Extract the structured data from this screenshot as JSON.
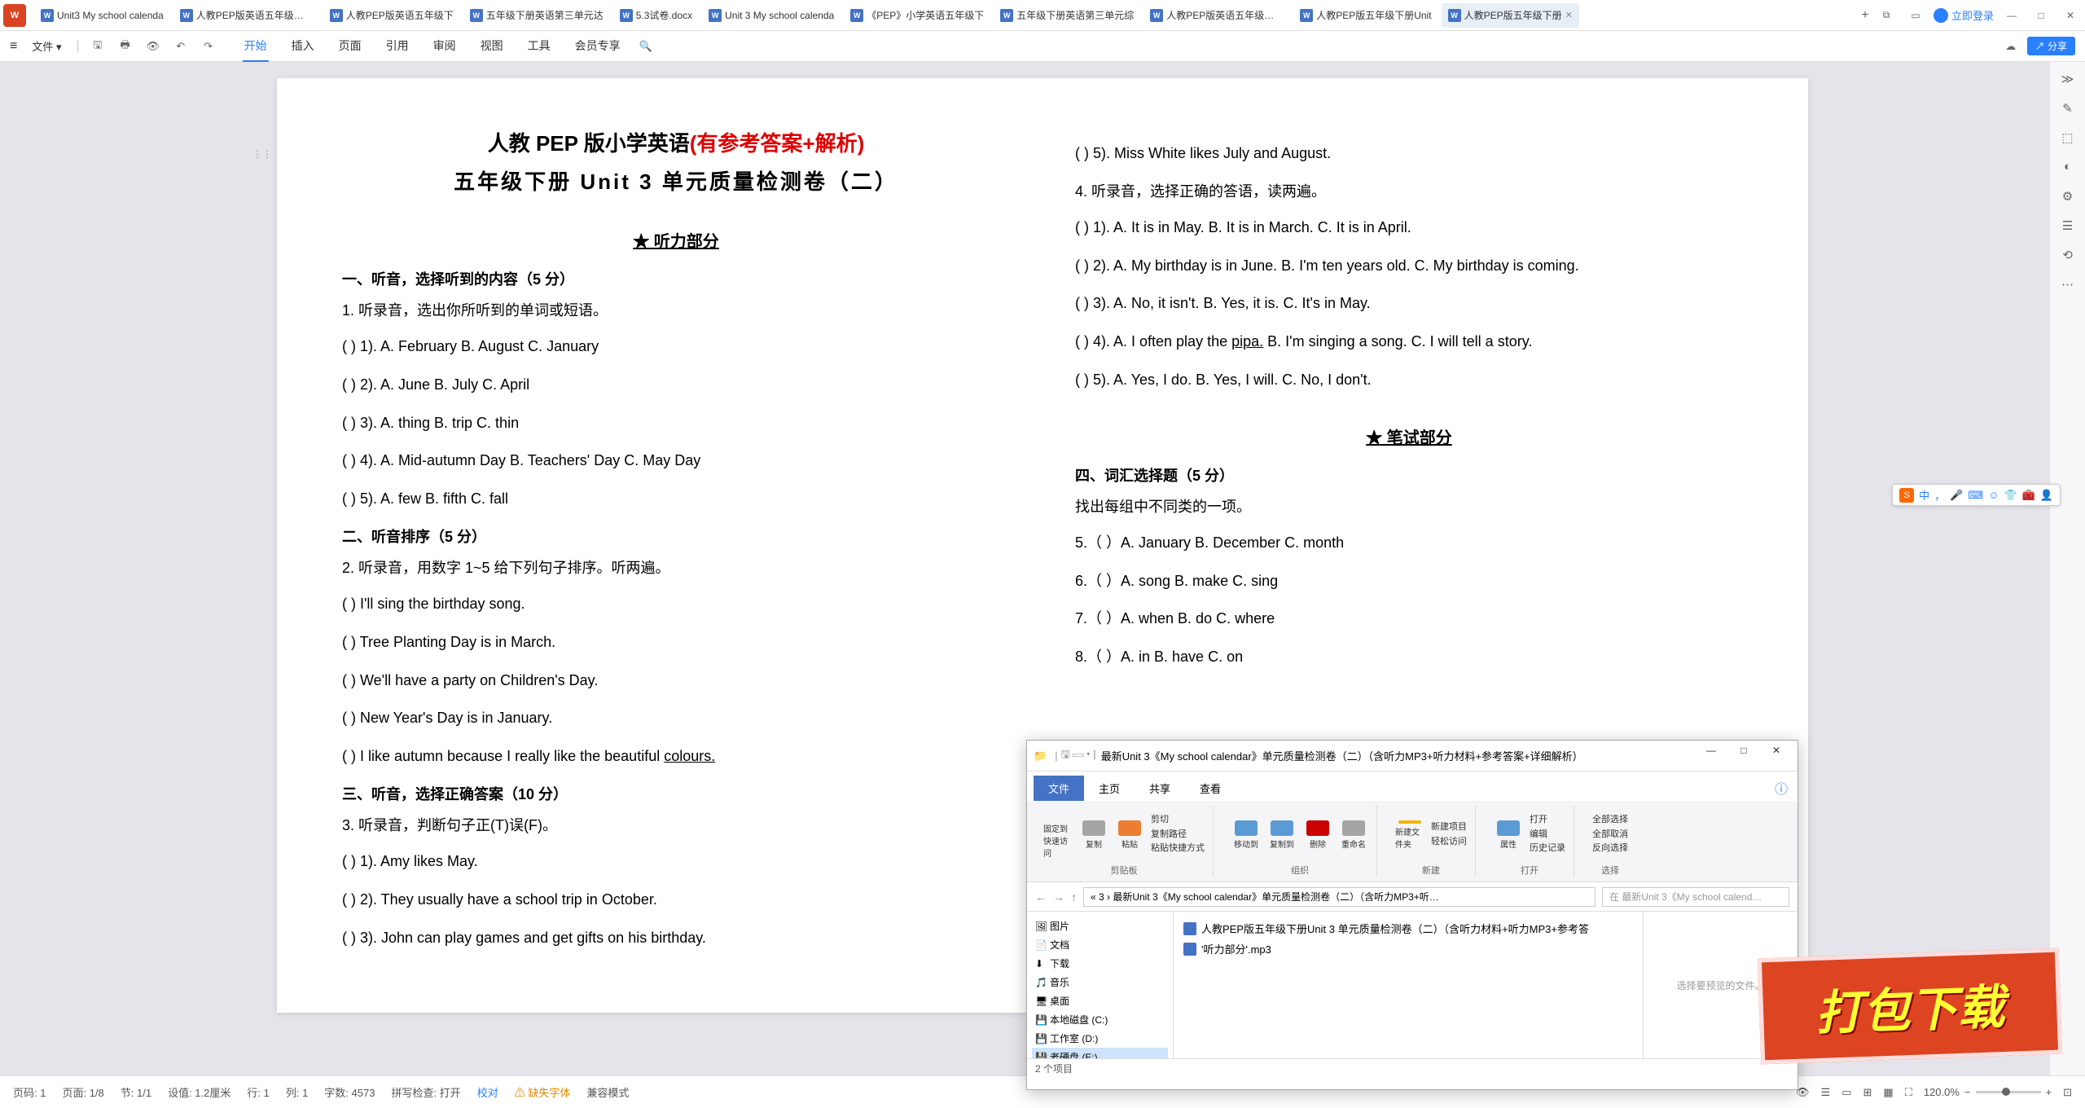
{
  "titlebar": {
    "tabs": [
      {
        "label": "Unit3  My school calenda"
      },
      {
        "label": "人教PEP版英语五年级下册U"
      },
      {
        "label": "人教PEP版英语五年级下"
      },
      {
        "label": "五年级下册英语第三单元达"
      },
      {
        "label": "5.3试卷.docx"
      },
      {
        "label": "Unit 3 My school calenda"
      },
      {
        "label": "《PEP》小学英语五年级下"
      },
      {
        "label": "五年级下册英语第三单元综"
      },
      {
        "label": "人教PEP版英语五年级下册U"
      },
      {
        "label": "人教PEP版五年级下册Unit"
      },
      {
        "label": "人教PEP版五年级下册"
      }
    ],
    "login": "立即登录",
    "share": "分享"
  },
  "ribbon": {
    "file": "文件",
    "tabs": [
      "开始",
      "插入",
      "页面",
      "引用",
      "审阅",
      "视图",
      "工具",
      "会员专享"
    ]
  },
  "doc": {
    "title1": "人教 PEP 版小学英语",
    "title_red": "(有参考答案+解析)",
    "title2": "五年级下册 Unit  3 单元质量检测卷（二）",
    "listening_header": "★  听力部分",
    "s1_title": "一、听音，选择听到的内容（5 分）",
    "s1_inst": "1.  听录音，选出你所听到的单词或短语。",
    "q1": "(          ) 1). A.  February                B.  August                  C.  January",
    "q2": "(          ) 2). A.  June                        B.  July                       C.  April",
    "q3": "(          ) 3). A.  thing                       B.  trip                        C.  thin",
    "q4": "(          ) 4). A.  Mid-autumn Day       B.  Teachers' Day          C.  May Day",
    "q5": "(          ) 5). A.  few                         B.  fifth                       C.  fall",
    "s2_title": "二、听音排序（5 分）",
    "s2_inst": "2.  听录音，用数字 1~5 给下列句子排序。听两遍。",
    "q6": "(          ) I'll sing the birthday song.",
    "q7": "(          ) Tree Planting Day is in March.",
    "q8": "(          ) We'll have a party on Children's Day.",
    "q9": "(          ) New Year's Day is in January.",
    "q10": "(          ) I like autumn because I really like the beautiful ",
    "q10u": "colours.",
    "s3_title": "三、听音，选择正确答案（10 分）",
    "s3_inst": "3.  听录音，判断句子正(T)误(F)。",
    "q11": "(          ) 1). Amy likes May.",
    "q12": "(          ) 2). They usually have a school trip in October.",
    "q13": "(          ) 3). John can play games and get gifts on his birthday.",
    "rq1": "(          ) 5). Miss White likes July and August.",
    "s4_inst": "4.  听录音，选择正确的答语，读两遍。",
    "rq2": "(          ) 1). A.  It is in May.             B.  It is in March.           C.  It is in April.",
    "rq3": "(          ) 2). A.  My birthday is in June.     B.  I'm ten years old.       C.  My birthday is coming.",
    "rq4": "(          ) 3). A.  No, it isn't.              B.  Yes, it is.                C.  It's in May.",
    "rq5a": "(          ) 4). A.  I often play the ",
    "rq5u": "pipa.",
    "rq5b": "        B.  I'm singing a song.       C.  I will tell a story.",
    "rq6": "(          ) 5). A.  Yes, I do.                 B.  Yes, I will.              C.  No, I don't.",
    "writing_header": "★  笔试部分",
    "s5_title": "四、词汇选择题（5 分）",
    "s5_inst": "找出每组中不同类的一项。",
    "wq5": "5.（       ）A.  January  B.  December               C.  month",
    "wq6": "6.（       ）A.  song        B.  make                       C.  sing",
    "wq7": "7.（       ）A.  when       B.  do                           C.  where",
    "wq8": "8.（       ）A.  in            B.  have                        C.  on"
  },
  "status": {
    "page": "页码: 1",
    "pages": "页面: 1/8",
    "section": "节: 1/1",
    "setting": "设值: 1.2厘米",
    "row": "行: 1",
    "col": "列: 1",
    "chars": "字数: 4573",
    "spell": "拼写检查: 打开",
    "proof": "校对",
    "missing": "缺失字体",
    "compat": "兼容模式",
    "zoom": "120.0%",
    "items": "2 个项目"
  },
  "explorer": {
    "title": "最新Unit 3《My school calendar》单元质量检测卷（二）（含听力MP3+听力材料+参考答案+详细解析）",
    "tabs": [
      "文件",
      "主页",
      "共享",
      "查看"
    ],
    "grp1": {
      "a": "固定到快速访问",
      "b": "复制",
      "c": "粘贴",
      "d": "剪切",
      "label": "剪贴板",
      "e": "复制路径",
      "f": "粘贴快捷方式"
    },
    "grp2": {
      "a": "移动到",
      "b": "复制到",
      "c": "删除",
      "d": "重命名",
      "label": "组织"
    },
    "grp3": {
      "a": "新建文件夹",
      "b": "新建项目",
      "c": "轻松访问",
      "label": "新建"
    },
    "grp4": {
      "a": "属性",
      "b": "打开",
      "c": "编辑",
      "d": "历史记录",
      "label": "打开"
    },
    "grp5": {
      "a": "全部选择",
      "b": "全部取消",
      "c": "反向选择",
      "label": "选择"
    },
    "path": "« 3 › 最新Unit 3《My school calendar》单元质量检测卷（二）（含听力MP3+听…",
    "search_ph": "在 最新Unit 3《My school calend…",
    "tree": [
      "图片",
      "文档",
      "下载",
      "音乐",
      "桌面",
      "本地磁盘 (C:)",
      "工作室 (D:)",
      "老硬盘 (E:)"
    ],
    "files": [
      "人教PEP版五年级下册Unit 3 单元质量检测卷（二）（含听力材料+听力MP3+参考答",
      "'听力部分'.mp3"
    ],
    "preview": "选择要预览的文件。"
  },
  "dl": "打包下载",
  "ime": {
    "cn": "中"
  }
}
